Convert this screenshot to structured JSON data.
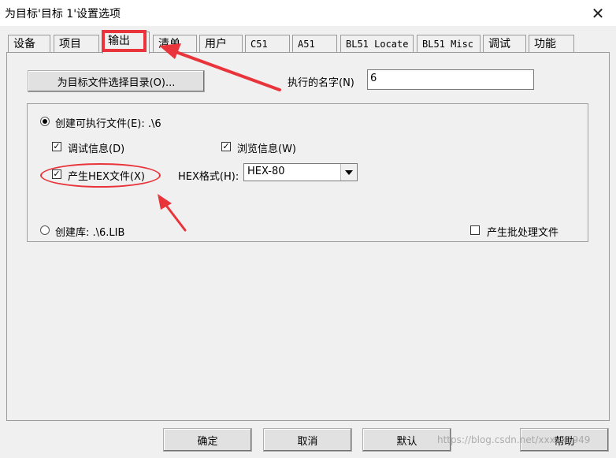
{
  "window": {
    "title": "为目标'目标 1'设置选项",
    "close_glyph": "✕"
  },
  "tabs": [
    {
      "label": "设备"
    },
    {
      "label": "项目"
    },
    {
      "label": "输出",
      "active": true
    },
    {
      "label": "清单"
    },
    {
      "label": "用户"
    },
    {
      "label": "C51"
    },
    {
      "label": "A51"
    },
    {
      "label": "BL51 Locate"
    },
    {
      "label": "BL51 Misc"
    },
    {
      "label": "调试"
    },
    {
      "label": "功能"
    }
  ],
  "output": {
    "select_dir_button": "为目标文件选择目录(O)...",
    "exe_name_label": "执行的名字(N)",
    "exe_name_value": "6",
    "create_exe_label": "创建可执行文件(E):  .\\6",
    "create_exe_selected": true,
    "debug_info_label": "调试信息(D)",
    "debug_info_checked": true,
    "browse_info_label": "浏览信息(W)",
    "browse_info_checked": true,
    "hex_file_label": "产生HEX文件(X)",
    "hex_file_checked": true,
    "hex_format_label": "HEX格式(H):",
    "hex_format_value": "HEX-80",
    "create_lib_label": "创建库:  .\\6.LIB",
    "create_lib_selected": false,
    "batch_file_label": "产生批处理文件",
    "batch_file_checked": false
  },
  "footer": {
    "ok": "确定",
    "cancel": "取消",
    "defaults": "默认",
    "help": "帮助"
  },
  "watermark": "https://blog.csdn.net/xxxxx1949",
  "colors": {
    "annotation_red": "#e8343a"
  }
}
